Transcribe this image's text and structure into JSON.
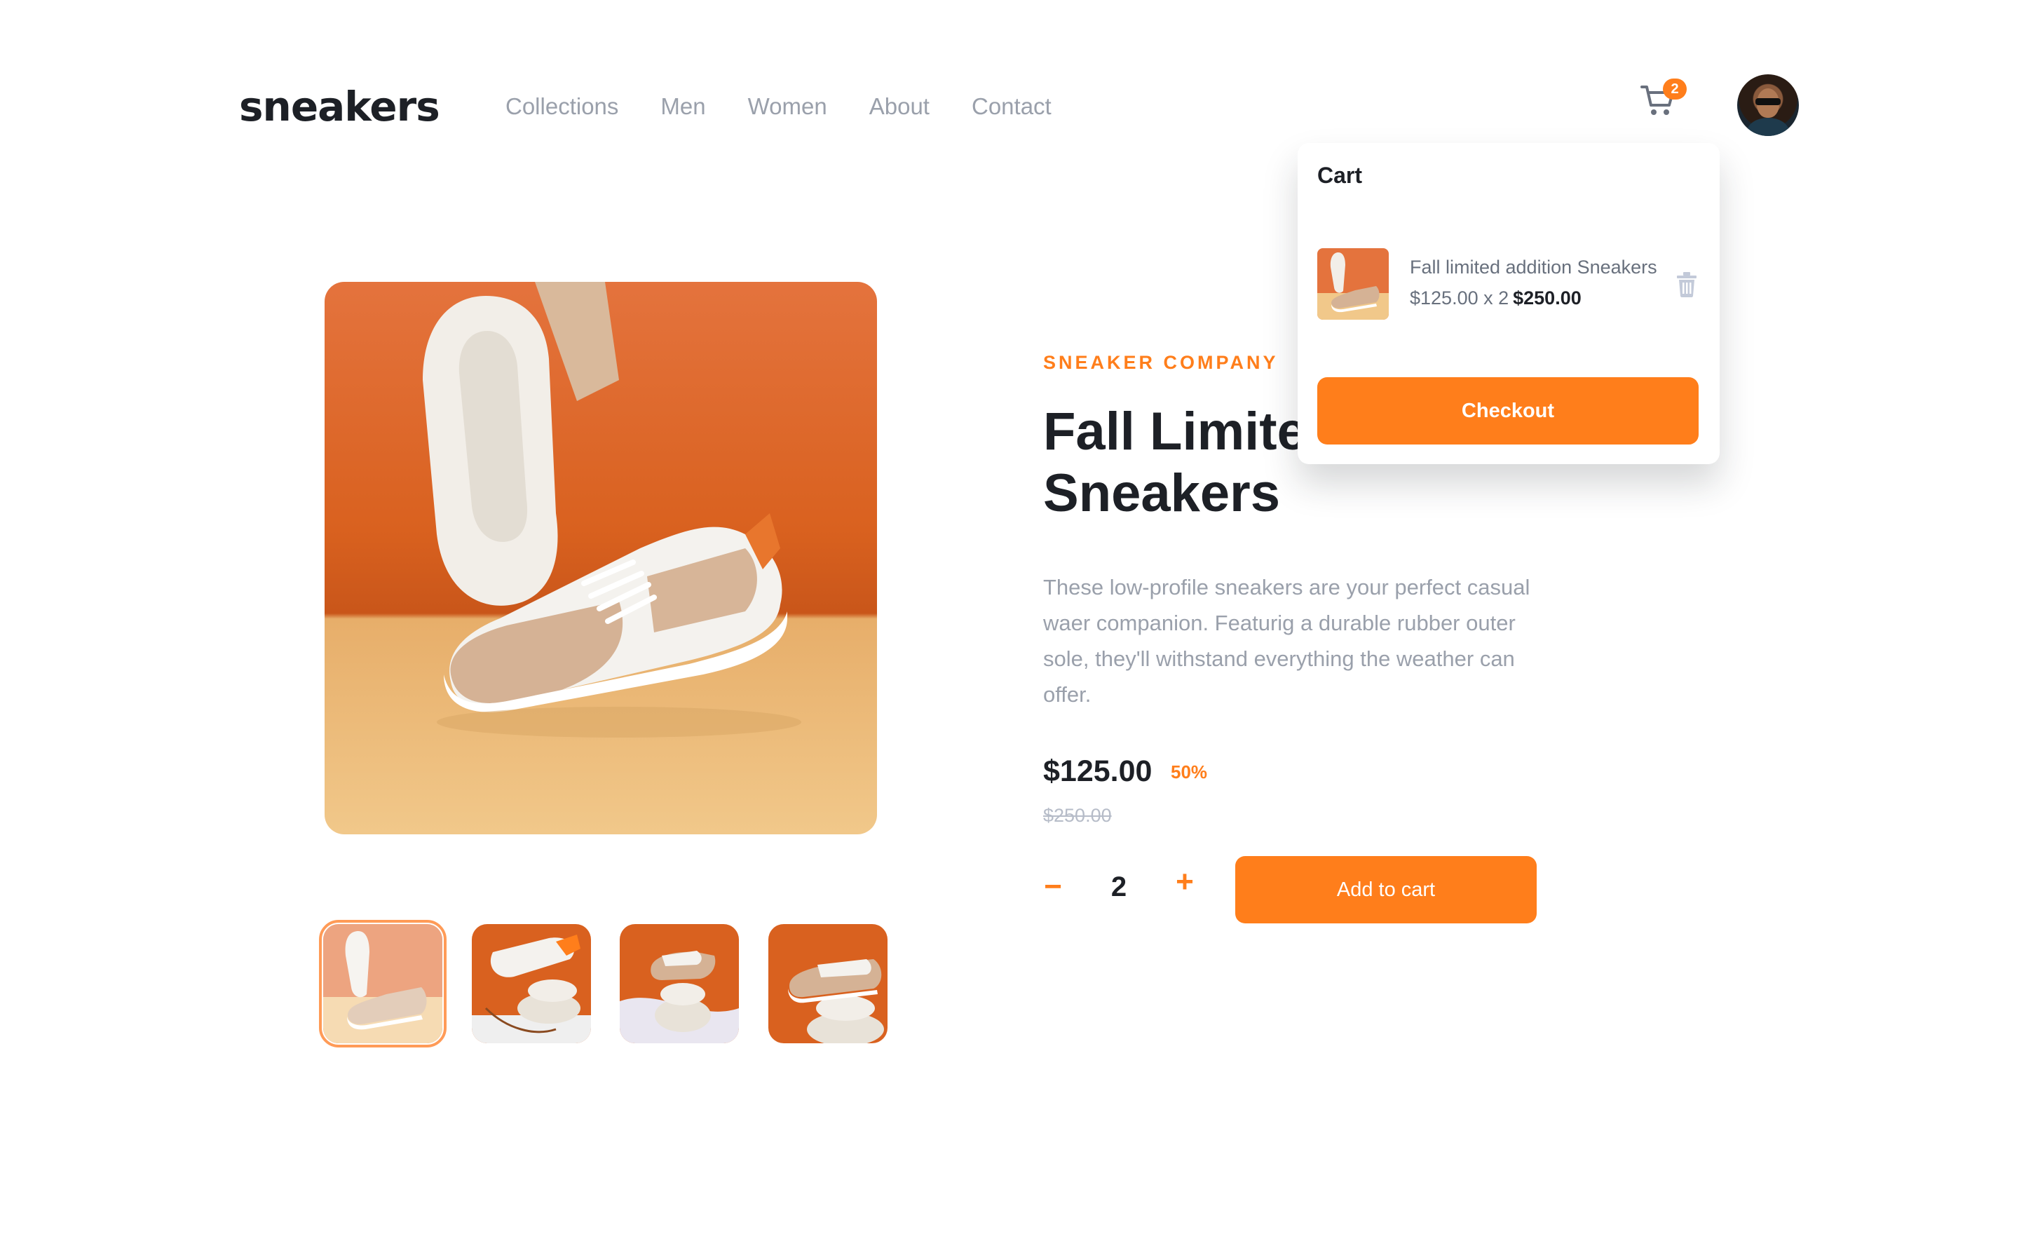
{
  "brand": {
    "logo_text": "sneakers"
  },
  "nav": {
    "items": [
      {
        "label": "Collections"
      },
      {
        "label": "Men"
      },
      {
        "label": "Women"
      },
      {
        "label": "About"
      },
      {
        "label": "Contact"
      }
    ]
  },
  "header": {
    "cart_icon": "cart-icon",
    "cart_count": "2",
    "avatar": "user-avatar"
  },
  "product": {
    "company": "SNEAKER COMPANY",
    "title": "Fall Limited Edition Sneakers",
    "description": "These low-profile sneakers are your perfect casual waer companion. Featurig a durable rubber outer sole, they'll withstand everything the weather can offer.",
    "price": "$125.00",
    "discount": "50%",
    "original_price": "$250.00",
    "quantity": "2",
    "minus_label": "−",
    "plus_label": "+",
    "add_to_cart_label": "Add to cart",
    "thumbnails": [
      {
        "name": "product-thumbnail-1",
        "active": true
      },
      {
        "name": "product-thumbnail-2",
        "active": false
      },
      {
        "name": "product-thumbnail-3",
        "active": false
      },
      {
        "name": "product-thumbnail-4",
        "active": false
      }
    ]
  },
  "cart": {
    "title": "Cart",
    "item": {
      "name": "Fall limited addition Sneakers",
      "unit_calc": "$125.00 x 2",
      "total": "$250.00",
      "delete_icon": "trash-icon"
    },
    "checkout_label": "Checkout"
  },
  "colors": {
    "accent": "#ff7e1b",
    "text_dark": "#1d2026",
    "text_muted": "#9aa0ab",
    "pale_orange": "#ffede0"
  }
}
